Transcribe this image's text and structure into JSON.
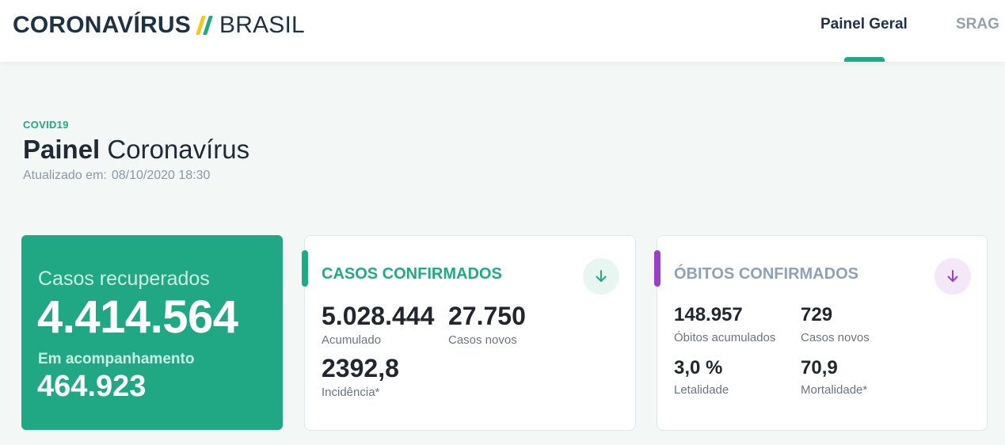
{
  "header": {
    "logo_bold": "CORONAVÍRUS",
    "logo_light": "BRASIL",
    "slash_colors": [
      "#f7c71c",
      "#1eaa82"
    ],
    "nav": [
      {
        "label": "Painel Geral",
        "active": true
      },
      {
        "label": "SRAG",
        "active": false
      }
    ],
    "indicator_color": "#1eaa82"
  },
  "page": {
    "eyebrow": "COVID19",
    "title_bold": "Painel",
    "title_regular": "Coronavírus",
    "updated_label": "Atualizado em:",
    "updated_value": "08/10/2020 18:30"
  },
  "recuperados": {
    "label": "Casos recuperados",
    "value": "4.414.564",
    "acomp_label": "Em acompanhamento",
    "acomp_value": "464.923",
    "bg_color": "#20a884"
  },
  "confirmados": {
    "title": "CASOS CONFIRMADOS",
    "accent_color": "#1eaa82",
    "button_bg": "#e8f6f1",
    "icon": "arrow-down-icon",
    "acumulado_value": "5.028.444",
    "acumulado_label": "Acumulado",
    "novos_value": "27.750",
    "novos_label": "Casos novos",
    "incidencia_value": "2392,8",
    "incidencia_label": "Incidência*"
  },
  "obitos": {
    "title": "ÓBITOS CONFIRMADOS",
    "accent_color": "#9b3ec9",
    "title_color": "#8fa2b5",
    "button_bg": "#f4e7f8",
    "icon": "arrow-down-icon",
    "acumulados_value": "148.957",
    "acumulados_label": "Óbitos acumulados",
    "novos_value": "729",
    "novos_label": "Casos novos",
    "letalidade_value": "3,0 %",
    "letalidade_label": "Letalidade",
    "mortalidade_value": "70,9",
    "mortalidade_label": "Mortalidade*"
  }
}
